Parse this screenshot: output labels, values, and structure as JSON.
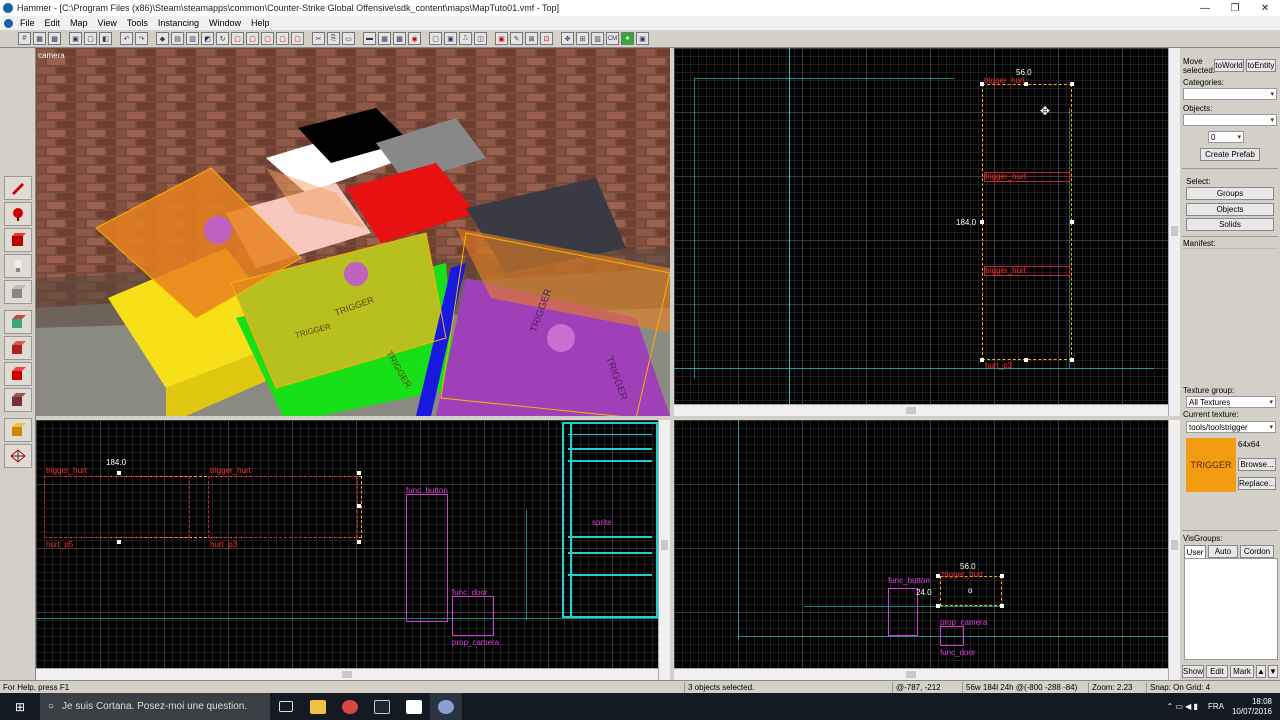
{
  "window": {
    "title": "Hammer - [C:\\Program Files (x86)\\Steam\\steamapps\\common\\Counter-Strike Global Offensive\\sdk_content\\maps\\MapTuto01.vmf - Top]",
    "minimize": "—",
    "restore": "❐",
    "close": "✕"
  },
  "menu": [
    "File",
    "Edit",
    "Map",
    "View",
    "Tools",
    "Instancing",
    "Window",
    "Help"
  ],
  "viewports": {
    "camera": {
      "label": "camera"
    },
    "top": {
      "dim_width": "56.0",
      "dim_height": "184.0",
      "entity_labels": [
        "trigger_hurt",
        "trigger_hurt",
        "trigger_hurt",
        "hurt_p3"
      ]
    },
    "front": {
      "dim_width": "184.0",
      "entity_labels": [
        "trigger_hurt",
        "hurt_p5",
        "trigger_hurt",
        "hurt_p3",
        "func_button",
        "func_door",
        "sprite",
        "prop_camera"
      ]
    },
    "side": {
      "dim_width": "56.0",
      "dim_height": "24.0",
      "entity_labels": [
        "func_button",
        "trigger_hurt",
        "prop_camera",
        "func_door"
      ]
    }
  },
  "camera_scene": {
    "trigger_text": "TRIGGER"
  },
  "right_panel": {
    "move_selected_label": "Move selected:",
    "to_world": "toWorld",
    "to_entity": "toEntity",
    "categories_label": "Categories:",
    "objects_label": "Objects:",
    "objects_value": "0",
    "create_prefab": "Create Prefab",
    "select_label": "Select:",
    "groups": "Groups",
    "objects": "Objects",
    "solids": "Solids",
    "manifest_label": "Manifest:",
    "texture_group_label": "Texture group:",
    "texture_group_value": "All Textures",
    "current_texture_label": "Current texture:",
    "current_texture_value": "tools/toolstrigger",
    "texture_size": "64x64",
    "texture_preview_text": "TRIGGER",
    "browse": "Browse...",
    "replace": "Replace...",
    "visgroups_label": "VisGroups:",
    "vis_tabs": [
      "User",
      "Auto",
      "Cordon"
    ],
    "bottom_buttons": [
      "Show",
      "Edit",
      "Mark"
    ]
  },
  "status": {
    "help": "For Help, press F1",
    "selection": "3 objects selected.",
    "coords": "@-787, -212",
    "size": "56w 184l 24h @(-800 -288 -84)",
    "zoom": "Zoom: 2.23",
    "snap": "Snap: On Grid: 4"
  },
  "taskbar": {
    "search_placeholder": "Je suis Cortana. Posez-moi une question.",
    "lang": "FRA",
    "time": "18:08",
    "date": "10/07/2016"
  },
  "colors": {
    "trigger_orange": "#f39c12",
    "selection_yellow": "#ffb000",
    "entity_red": "#ff3030",
    "grid_cyan": "#20c0c0",
    "entity_magenta": "#d040d0"
  }
}
